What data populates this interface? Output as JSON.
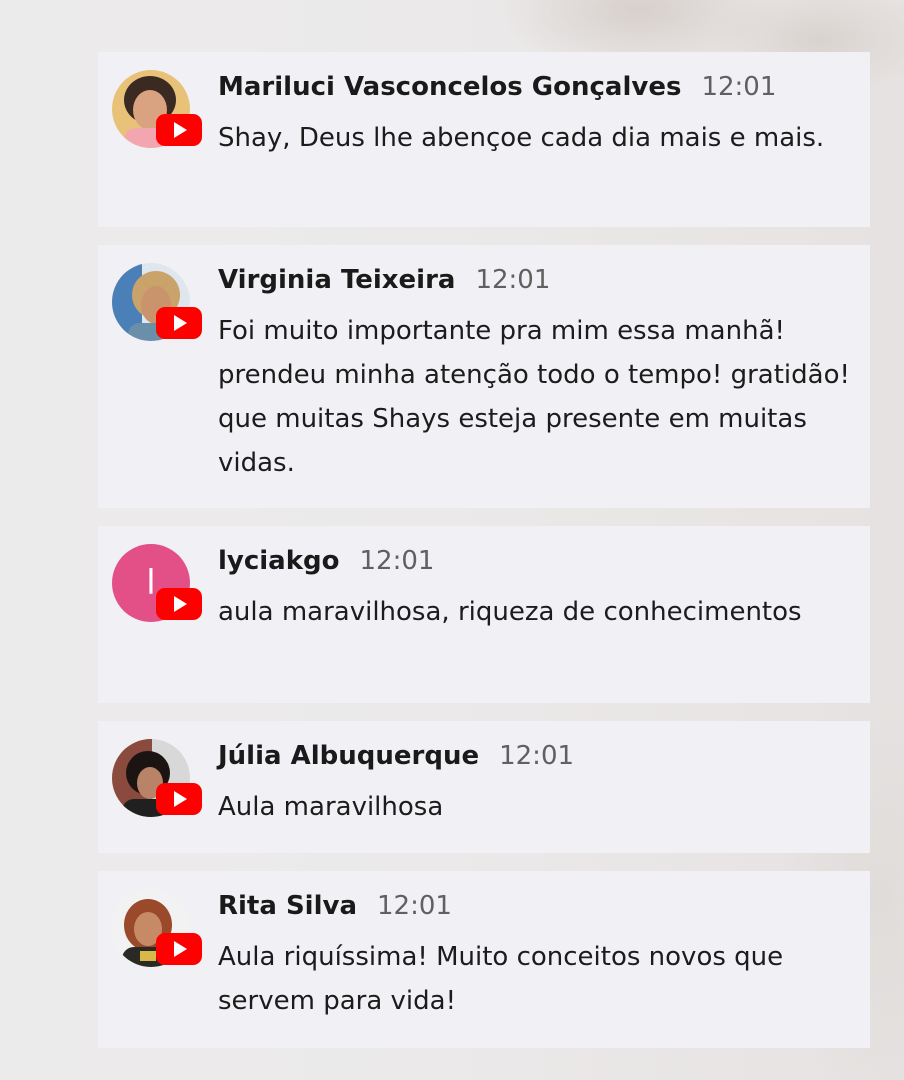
{
  "comments": [
    {
      "author": "Mariluci Vasconcelos Gonçalves",
      "time": "12:01",
      "message": "Shay, Deus lhe abençoe cada dia mais e mais.",
      "avatar": {
        "type": "photo",
        "bg": "#e9c27a",
        "face": "#d9a382",
        "hair": "#3a2a22"
      }
    },
    {
      "author": "Virginia Teixeira",
      "time": "12:01",
      "message": "Foi muito importante pra mim essa manhã! prendeu minha atenção todo o tempo! gratidão! que muitas Shays esteja presente em muitas vidas.",
      "avatar": {
        "type": "photo",
        "bg": "#4a7fb8",
        "face": "#c9946c",
        "hair": "#c9a36a"
      }
    },
    {
      "author": "lyciakgo",
      "time": "12:01",
      "message": "aula maravilhosa, riqueza de conhecimentos",
      "avatar": {
        "type": "initial",
        "initial": "l",
        "bg": "#e34f87"
      }
    },
    {
      "author": "Júlia Albuquerque",
      "time": "12:01",
      "message": "Aula maravilhosa",
      "avatar": {
        "type": "photo",
        "bg": "#8a4a3e",
        "face": "#b98368",
        "hair": "#1c1412"
      }
    },
    {
      "author": "Rita Silva",
      "time": "12:01",
      "message": "Aula riquíssima! Muito conceitos novos que servem para vida!",
      "avatar": {
        "type": "photo",
        "bg": "#f2f2f2",
        "face": "#c68b66",
        "hair": "#9a4a2a"
      }
    }
  ],
  "badge": {
    "platform": "youtube-icon",
    "color": "#ff0000"
  }
}
